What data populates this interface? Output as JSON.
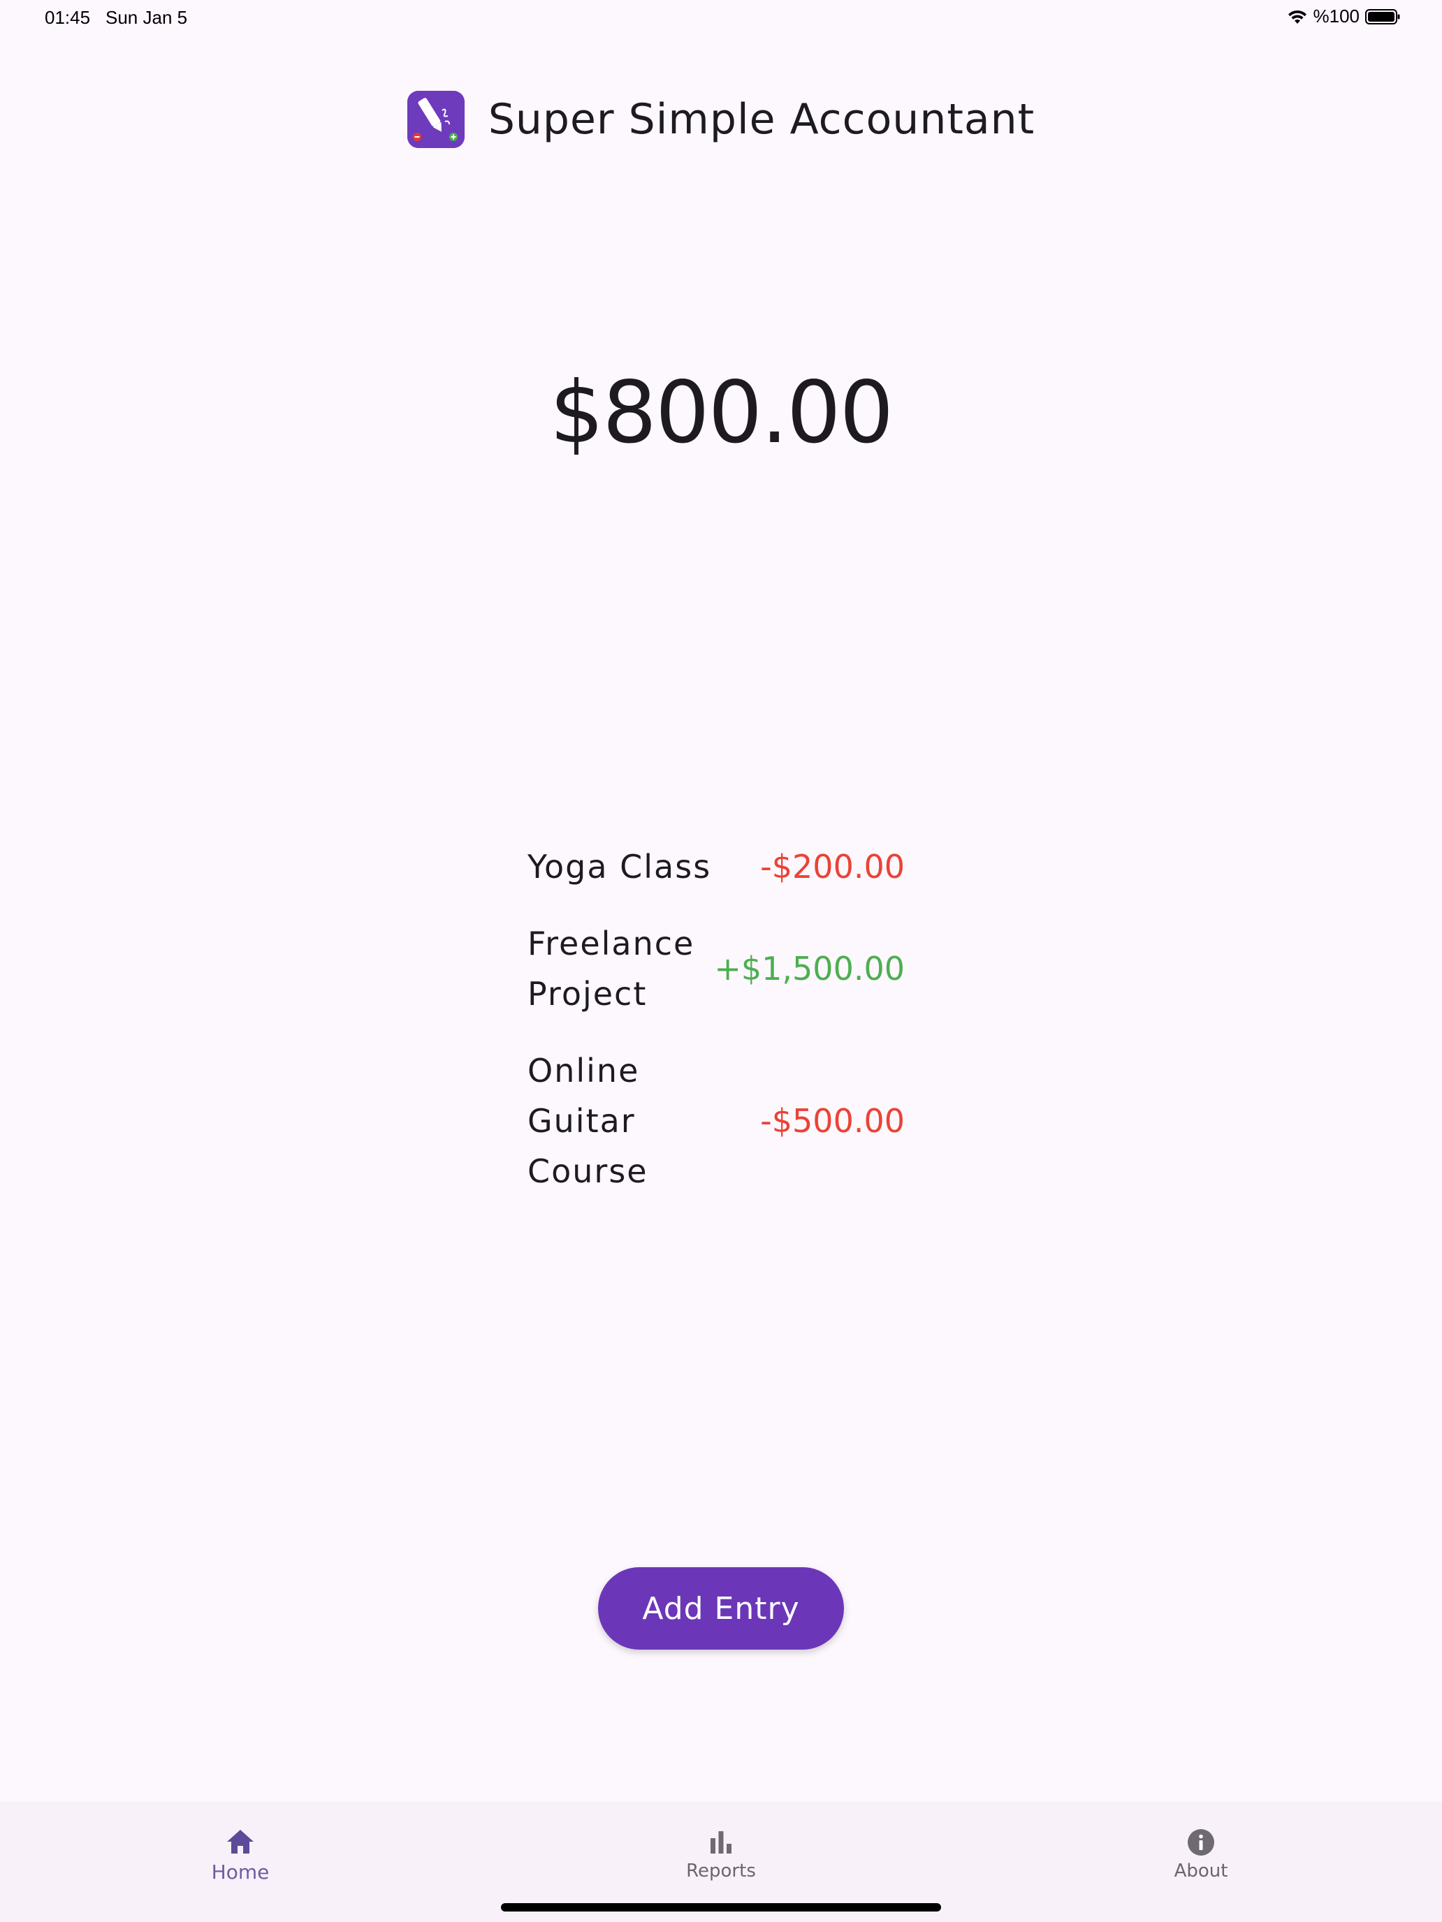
{
  "status_bar": {
    "time": "01:45",
    "date": "Sun Jan 5",
    "battery": "%100",
    "icons": [
      "wifi-icon",
      "battery-icon"
    ]
  },
  "app": {
    "title": "Super Simple Accountant",
    "logo_icon": "app-logo-icon"
  },
  "balance": "$800.00",
  "entries": [
    {
      "name": "Yoga Class",
      "amount": "-$200.00",
      "type": "expense"
    },
    {
      "name": "Freelance Project",
      "amount": "+$1,500.00",
      "type": "income"
    },
    {
      "name": "Online Guitar Course",
      "amount": "-$500.00",
      "type": "expense"
    }
  ],
  "actions": {
    "add_entry_label": "Add Entry"
  },
  "bottom_nav": {
    "items": [
      {
        "label": "Home",
        "icon": "home-icon",
        "active": true
      },
      {
        "label": "Reports",
        "icon": "bar-chart-icon",
        "active": false
      },
      {
        "label": "About",
        "icon": "info-icon",
        "active": false
      }
    ]
  },
  "colors": {
    "background": "#fdf7fe",
    "accent": "#6b37b8",
    "expense": "#ea4335",
    "income": "#4caf50",
    "nav_active": "#6b5ea1"
  }
}
